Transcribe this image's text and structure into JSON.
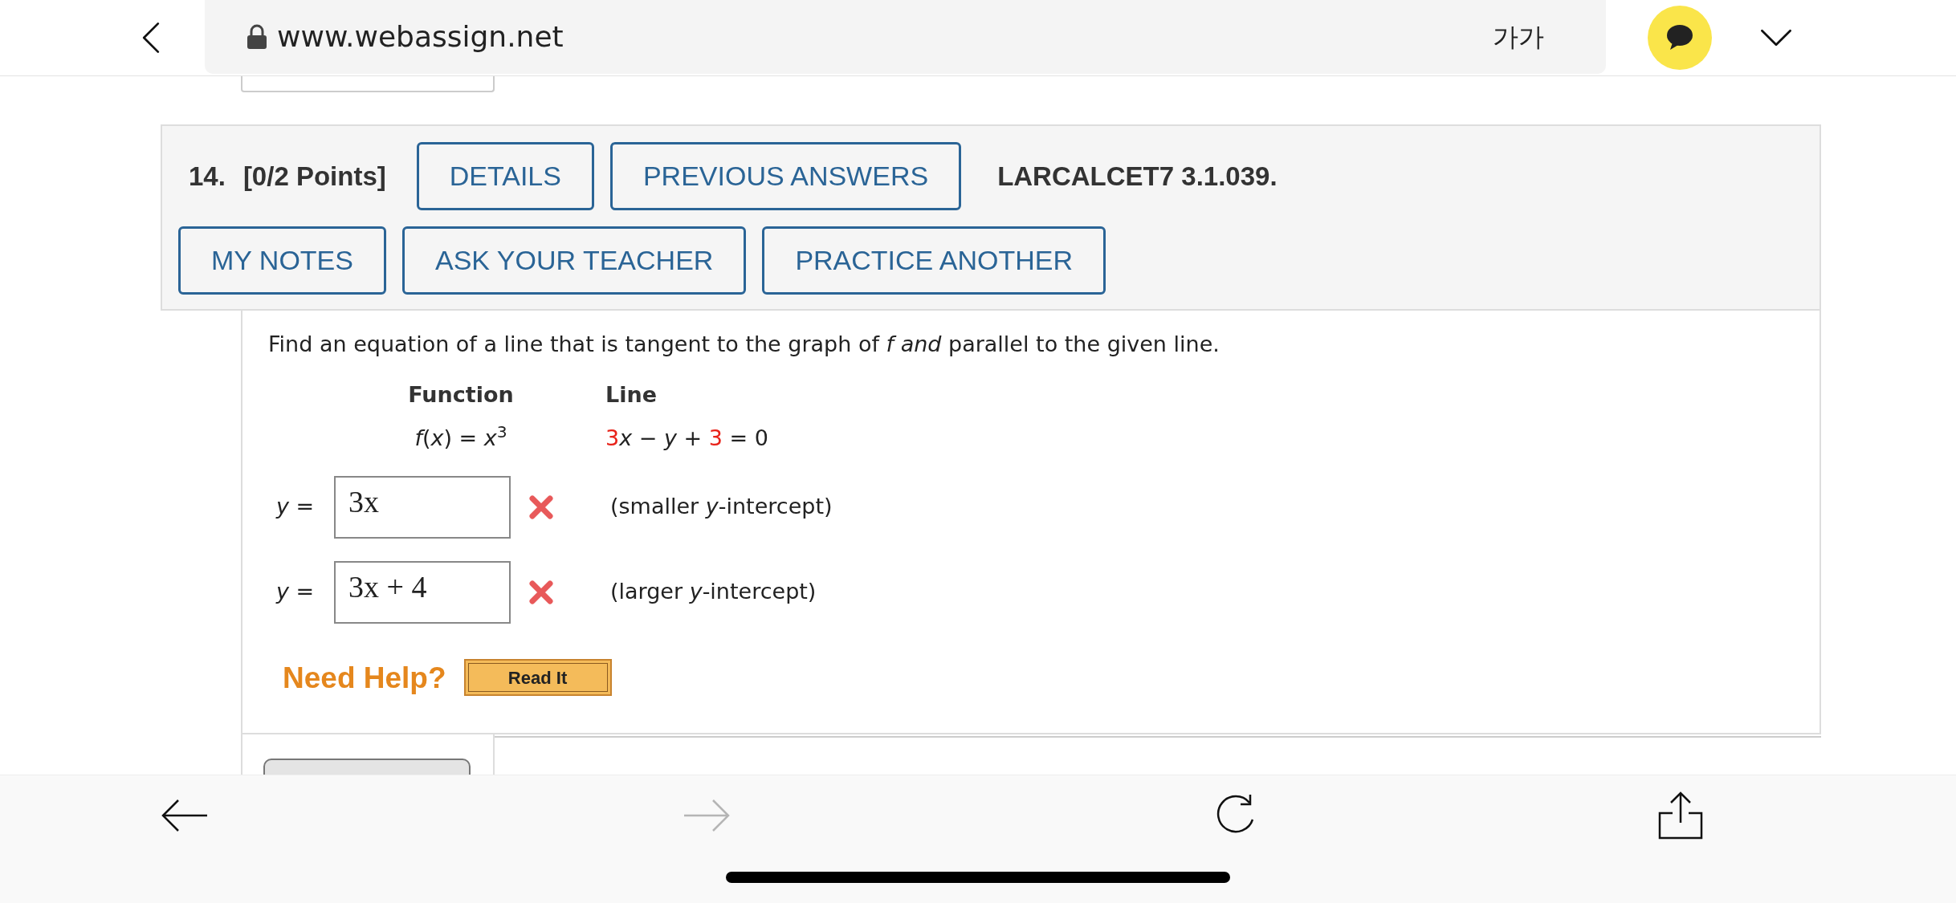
{
  "browser": {
    "url": "www.webassign.net",
    "text_size_button": "가가",
    "forward_enabled": false
  },
  "question": {
    "number": "14.",
    "points": "[0/2 Points]",
    "row_1_buttons": [
      "DETAILS",
      "PREVIOUS ANSWERS"
    ],
    "reference": "LARCALCET7 3.1.039.",
    "row_2_buttons": [
      "MY NOTES",
      "ASK YOUR TEACHER",
      "PRACTICE ANOTHER"
    ],
    "prompt": "Find an equation of a line that is tangent to the graph of *f and* parallel to the given line.",
    "table": {
      "headers": [
        "Function",
        "Line"
      ],
      "function": "*f*(*x*) = *x*$^{3}$",
      "line_parts": [
        {
          "text": "3",
          "highlighted": true
        },
        {
          "text": "*x* − *y* + ",
          "highlighted": false
        },
        {
          "text": "3",
          "highlighted": true
        },
        {
          "text": " = 0",
          "highlighted": false
        }
      ]
    },
    "answers": [
      {
        "prefix": "*y* =",
        "value": "3x",
        "correct": false,
        "label": "(smaller *y*-intercept)"
      },
      {
        "prefix": "*y* =",
        "value": "3x + 4",
        "correct": false,
        "label": "(larger *y*-intercept)"
      }
    ],
    "help": {
      "title": "Need Help?",
      "buttons": [
        "Read It"
      ]
    }
  }
}
